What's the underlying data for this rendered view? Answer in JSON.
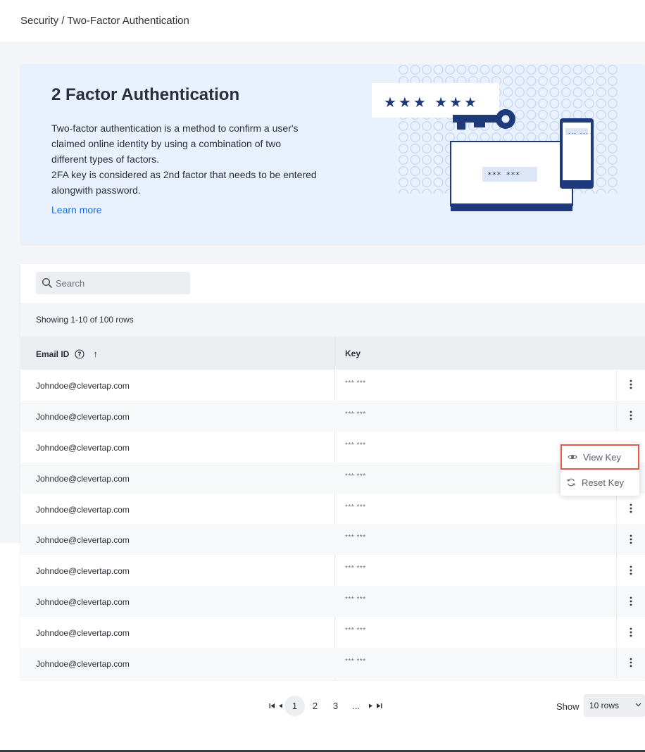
{
  "breadcrumb": "Security / Two-Factor Authentication",
  "hero": {
    "title": "2 Factor Authentication",
    "description_lines": [
      "Two-factor authentication is a method to confirm a user's claimed online identity by using a combination of two different types of factors.",
      "2FA key is considered as 2nd factor that needs to be entered alongwith password."
    ],
    "learn_more": "Learn more",
    "illustration": {
      "stars_top": "★★★ ★★★",
      "laptop_stars": "*** ***",
      "phone_dots": "... ..."
    }
  },
  "search": {
    "placeholder": "Search",
    "value": ""
  },
  "rows_info": "Showing 1-10 of 100 rows",
  "table": {
    "headers": {
      "email": "Email ID",
      "key": "Key"
    },
    "sort": "ascending",
    "rows": [
      {
        "email": "Johndoe@clevertap.com",
        "key": "*** ***"
      },
      {
        "email": "Johndoe@clevertap.com",
        "key": "*** ***"
      },
      {
        "email": "Johndoe@clevertap.com",
        "key": "*** ***"
      },
      {
        "email": "Johndoe@clevertap.com",
        "key": "*** ***"
      },
      {
        "email": "Johndoe@clevertap.com",
        "key": "*** ***"
      },
      {
        "email": "Johndoe@clevertap.com",
        "key": "*** ***"
      },
      {
        "email": "Johndoe@clevertap.com",
        "key": "*** ***"
      },
      {
        "email": "Johndoe@clevertap.com",
        "key": "*** ***"
      },
      {
        "email": "Johndoe@clevertap.com",
        "key": "*** ***"
      },
      {
        "email": "Johndoe@clevertap.com",
        "key": "*** ***"
      }
    ]
  },
  "row_menu": {
    "view_key": "View Key",
    "reset_key": "Reset Key"
  },
  "pagination": {
    "pages": [
      "1",
      "2",
      "3",
      "..."
    ],
    "current": "1"
  },
  "page_size": {
    "label": "Show",
    "value": "10 rows"
  },
  "colors": {
    "accent": "#1b6fd9",
    "navy": "#1f3a7a",
    "hero_bg": "#e9f1fd",
    "highlight": "#e35a4a"
  },
  "icons": {
    "search": "search-icon",
    "help": "help-circle-icon",
    "sort": "arrow-up-icon",
    "kebab": "kebab-menu-icon",
    "view": "eye-icon",
    "reset": "refresh-icon",
    "first": "first-page-icon",
    "prev": "prev-page-icon",
    "next": "next-page-icon",
    "last": "last-page-icon"
  }
}
